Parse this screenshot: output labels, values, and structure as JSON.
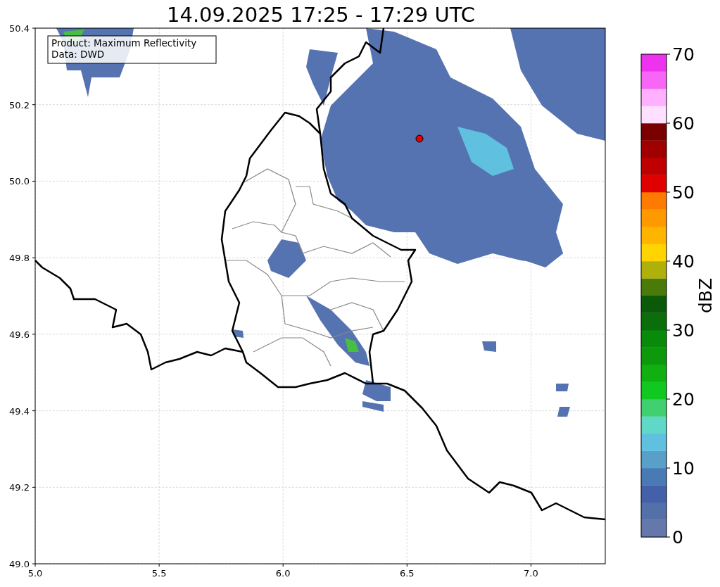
{
  "title": "14.09.2025 17:25 - 17:29 UTC",
  "map": {
    "info_box": [
      "Product: Maximum Reflectivity",
      "Data: DWD"
    ],
    "xticks": [
      "5.0",
      "5.5",
      "6.0",
      "6.5",
      "7.0"
    ],
    "yticks": [
      "50.4",
      "50.2",
      "50.0",
      "49.8",
      "49.6",
      "49.4",
      "49.2",
      "49.0"
    ]
  },
  "colorbar": {
    "label": "dBZ",
    "ticks": [
      "70",
      "60",
      "50",
      "40",
      "30",
      "20",
      "10",
      "0"
    ],
    "segments": [
      {
        "color": "#6478ac"
      },
      {
        "color": "#5470a8"
      },
      {
        "color": "#4460a8"
      },
      {
        "color": "#4a7ab4"
      },
      {
        "color": "#58a0c8"
      },
      {
        "color": "#60c0e0"
      },
      {
        "color": "#60d8c8"
      },
      {
        "color": "#40d070"
      },
      {
        "color": "#10c820"
      },
      {
        "color": "#10b010"
      },
      {
        "color": "#0c9a0c"
      },
      {
        "color": "#0a8a0a"
      },
      {
        "color": "#0a6e0a"
      },
      {
        "color": "#0a5a0a"
      },
      {
        "color": "#4a7a0a"
      },
      {
        "color": "#b0b00a"
      },
      {
        "color": "#ffd400"
      },
      {
        "color": "#ffb400"
      },
      {
        "color": "#ff9900"
      },
      {
        "color": "#ff7a00"
      },
      {
        "color": "#e00000"
      },
      {
        "color": "#c00000"
      },
      {
        "color": "#a00000"
      },
      {
        "color": "#7a0000"
      },
      {
        "color": "#ffe0ff"
      },
      {
        "color": "#ffb0ff"
      },
      {
        "color": "#f766f7"
      },
      {
        "color": "#ee33ee"
      }
    ]
  }
}
